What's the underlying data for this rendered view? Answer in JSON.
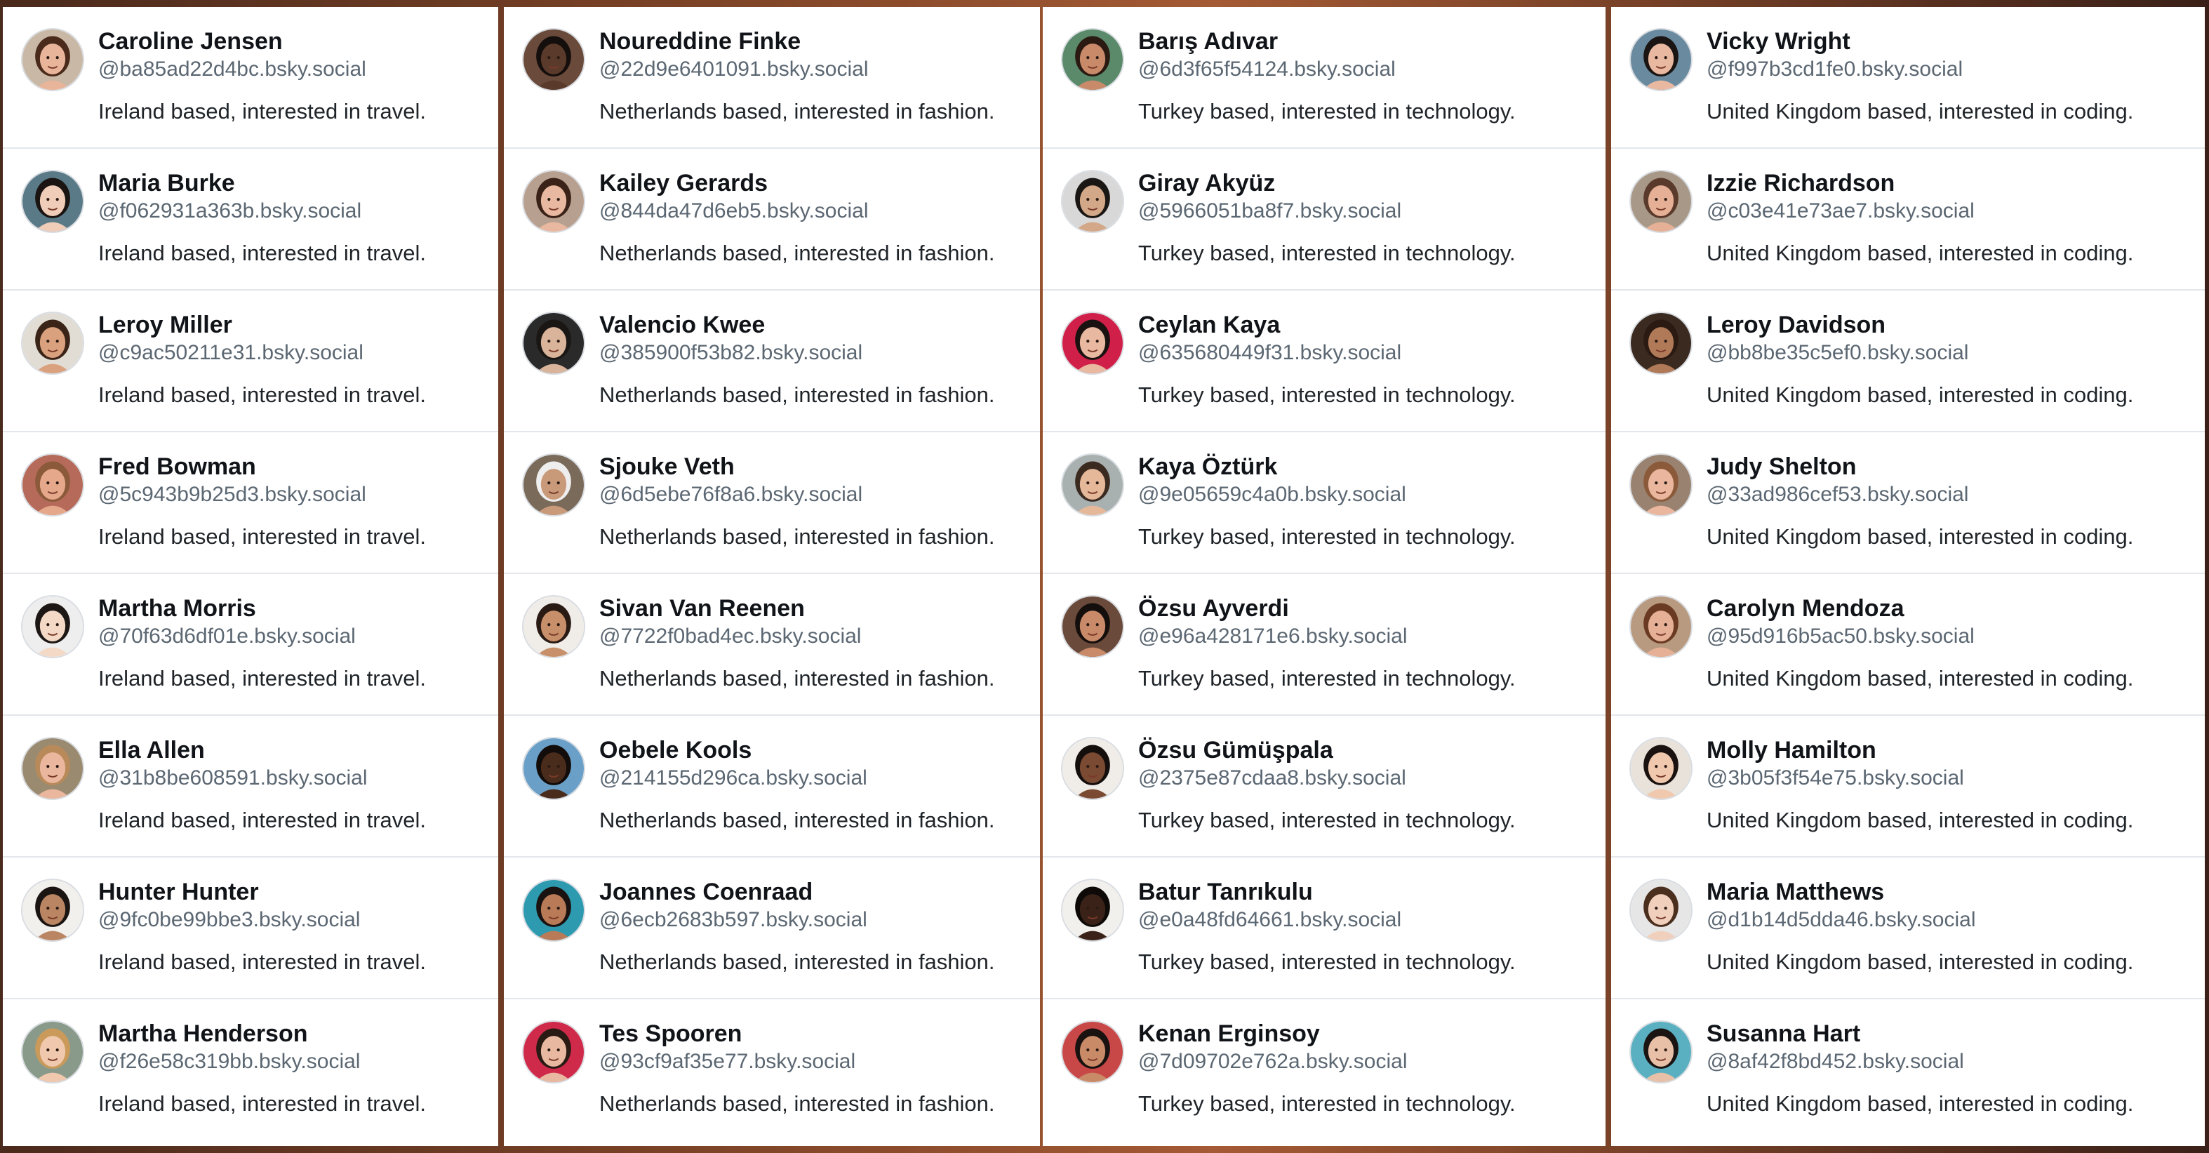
{
  "columns": [
    {
      "users": [
        {
          "name": "Caroline Jensen",
          "handle": "@ba85ad22d4bc.bsky.social",
          "bio": "Ireland based, interested in travel.",
          "skin": "#e8b49a",
          "hair": "#4a2a1a",
          "bg": "#c9b8a6"
        },
        {
          "name": "Maria Burke",
          "handle": "@f062931a363b.bsky.social",
          "bio": "Ireland based, interested in travel.",
          "skin": "#f0cdb8",
          "hair": "#1a1412",
          "bg": "#5a7a88"
        },
        {
          "name": "Leroy Miller",
          "handle": "@c9ac50211e31.bsky.social",
          "bio": "Ireland based, interested in travel.",
          "skin": "#d9a17e",
          "hair": "#3a2418",
          "bg": "#e2ddd4"
        },
        {
          "name": "Fred Bowman",
          "handle": "@5c943b9b25d3.bsky.social",
          "bio": "Ireland based, interested in travel.",
          "skin": "#e6a88a",
          "hair": "#8a5a3a",
          "bg": "#b56a5a"
        },
        {
          "name": "Martha Morris",
          "handle": "@70f63d6df01e.bsky.social",
          "bio": "Ireland based, interested in travel.",
          "skin": "#f3d9c6",
          "hair": "#1c1614",
          "bg": "#eeeeee"
        },
        {
          "name": "Ella Allen",
          "handle": "@31b8be608591.bsky.social",
          "bio": "Ireland based, interested in travel.",
          "skin": "#eab79e",
          "hair": "#b88a5a",
          "bg": "#9a8a70"
        },
        {
          "name": "Hunter Hunter",
          "handle": "@9fc0be99bbe3.bsky.social",
          "bio": "Ireland based, interested in travel.",
          "skin": "#b98562",
          "hair": "#1a1412",
          "bg": "#f2f0ec"
        },
        {
          "name": "Martha Henderson",
          "handle": "@f26e58c319bb.bsky.social",
          "bio": "Ireland based, interested in travel.",
          "skin": "#f0c8ae",
          "hair": "#c99a5a",
          "bg": "#8a9a8a"
        }
      ]
    },
    {
      "users": [
        {
          "name": "Noureddine Finke",
          "handle": "@22d9e6401091.bsky.social",
          "bio": "Netherlands based, interested in fashion.",
          "skin": "#5a3a2a",
          "hair": "#140e0c",
          "bg": "#6a4a3a"
        },
        {
          "name": "Kailey Gerards",
          "handle": "@844da47d6eb5.bsky.social",
          "bio": "Netherlands based, interested in fashion.",
          "skin": "#e8b8a0",
          "hair": "#3a2218",
          "bg": "#b8a090"
        },
        {
          "name": "Valencio Kwee",
          "handle": "@385900f53b82.bsky.social",
          "bio": "Netherlands based, interested in fashion.",
          "skin": "#d9b49a",
          "hair": "#1a1614",
          "bg": "#2a2a2a"
        },
        {
          "name": "Sjouke Veth",
          "handle": "@6d5ebe76f8a6.bsky.social",
          "bio": "Netherlands based, interested in fashion.",
          "skin": "#c99a7a",
          "hair": "#eeeeee",
          "bg": "#7a6a5a"
        },
        {
          "name": "Sivan Van Reenen",
          "handle": "@7722f0bad4ec.bsky.social",
          "bio": "Netherlands based, interested in fashion.",
          "skin": "#c8906a",
          "hair": "#2a1a14",
          "bg": "#f0ede8"
        },
        {
          "name": "Oebele Kools",
          "handle": "@214155d296ca.bsky.social",
          "bio": "Netherlands based, interested in fashion.",
          "skin": "#4a2c1c",
          "hair": "#120c0a",
          "bg": "#6aa0c8"
        },
        {
          "name": "Joannes Coenraad",
          "handle": "@6ecb2683b597.bsky.social",
          "bio": "Netherlands based, interested in fashion.",
          "skin": "#b97a58",
          "hair": "#1a1210",
          "bg": "#2e9ab0"
        },
        {
          "name": "Tes Spooren",
          "handle": "@93cf9af35e77.bsky.social",
          "bio": "Netherlands based, interested in fashion.",
          "skin": "#e8b8a0",
          "hair": "#2a1a14",
          "bg": "#d02a4a"
        }
      ]
    },
    {
      "users": [
        {
          "name": "Barış Adıvar",
          "handle": "@6d3f65f54124.bsky.social",
          "bio": "Turkey based, interested in technology.",
          "skin": "#c98a6a",
          "hair": "#2a1a12",
          "bg": "#5a8a6a"
        },
        {
          "name": "Giray Akyüz",
          "handle": "@5966051ba8f7.bsky.social",
          "bio": "Turkey based, interested in technology.",
          "skin": "#d2a888",
          "hair": "#1a1614",
          "bg": "#d8d8d8"
        },
        {
          "name": "Ceylan Kaya",
          "handle": "@635680449f31.bsky.social",
          "bio": "Turkey based, interested in technology.",
          "skin": "#e8b8a0",
          "hair": "#1a1210",
          "bg": "#d0204a"
        },
        {
          "name": "Kaya Öztürk",
          "handle": "@9e05659c4a0b.bsky.social",
          "bio": "Turkey based, interested in technology.",
          "skin": "#e6b89a",
          "hair": "#3a2a20",
          "bg": "#a8b0b0"
        },
        {
          "name": "Özsu Ayverdi",
          "handle": "@e96a428171e6.bsky.social",
          "bio": "Turkey based, interested in technology.",
          "skin": "#c98a6a",
          "hair": "#140e0c",
          "bg": "#6a4a3a"
        },
        {
          "name": "Özsu Gümüşpala",
          "handle": "@2375e87cdaa8.bsky.social",
          "bio": "Turkey based, interested in technology.",
          "skin": "#7a4a32",
          "hair": "#140e0c",
          "bg": "#f0ede8"
        },
        {
          "name": "Batur Tanrıkulu",
          "handle": "@e0a48fd64661.bsky.social",
          "bio": "Turkey based, interested in technology.",
          "skin": "#3a2218",
          "hair": "#0e0a08",
          "bg": "#f2f0ec"
        },
        {
          "name": "Kenan Erginsoy",
          "handle": "@7d09702e762a.bsky.social",
          "bio": "Turkey based, interested in technology.",
          "skin": "#c98a68",
          "hair": "#1a1210",
          "bg": "#c84848"
        }
      ]
    },
    {
      "users": [
        {
          "name": "Vicky Wright",
          "handle": "@f997b3cd1fe0.bsky.social",
          "bio": "United Kingdom based, interested in coding.",
          "skin": "#e8b8a0",
          "hair": "#1a1412",
          "bg": "#6a8aa0"
        },
        {
          "name": "Izzie Richardson",
          "handle": "@c03e41e73ae7.bsky.social",
          "bio": "United Kingdom based, interested in coding.",
          "skin": "#e6b096",
          "hair": "#5a3a2a",
          "bg": "#a89888"
        },
        {
          "name": "Leroy Davidson",
          "handle": "@bb8be35c5ef0.bsky.social",
          "bio": "United Kingdom based, interested in coding.",
          "skin": "#b07a58",
          "hair": "#2a1a12",
          "bg": "#3a2a20"
        },
        {
          "name": "Judy Shelton",
          "handle": "@33ad986cef53.bsky.social",
          "bio": "United Kingdom based, interested in coding.",
          "skin": "#eab79e",
          "hair": "#8a5a3a",
          "bg": "#9a8270"
        },
        {
          "name": "Carolyn Mendoza",
          "handle": "@95d916b5ac50.bsky.social",
          "bio": "United Kingdom based, interested in coding.",
          "skin": "#e6b096",
          "hair": "#6a3a22",
          "bg": "#b89a80"
        },
        {
          "name": "Molly Hamilton",
          "handle": "@3b05f3f54e75.bsky.social",
          "bio": "United Kingdom based, interested in coding.",
          "skin": "#f0c8ae",
          "hair": "#1a1210",
          "bg": "#e8e2da"
        },
        {
          "name": "Maria Matthews",
          "handle": "@d1b14d5dda46.bsky.social",
          "bio": "United Kingdom based, interested in coding.",
          "skin": "#f0d0bc",
          "hair": "#4a2e1e",
          "bg": "#e6e6e6"
        },
        {
          "name": "Susanna Hart",
          "handle": "@8af42f8bd452.bsky.social",
          "bio": "United Kingdom based, interested in coding.",
          "skin": "#e8c0a8",
          "hair": "#1a1412",
          "bg": "#5ab0c0"
        }
      ]
    }
  ]
}
